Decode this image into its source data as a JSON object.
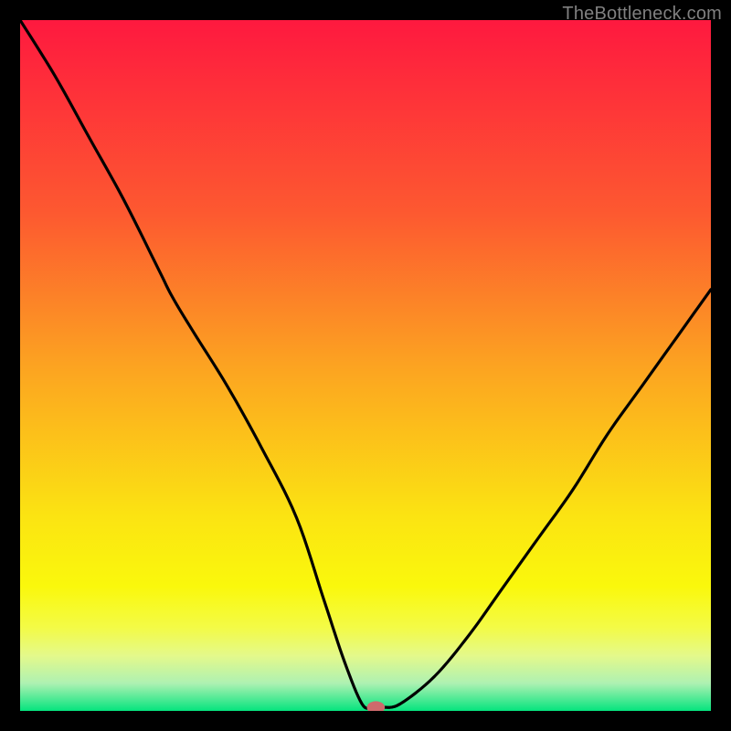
{
  "watermark": "TheBottleneck.com",
  "colors": {
    "page_bg": "#000000",
    "curve_stroke": "#000000",
    "marker_fill": "#ce6a6c",
    "watermark_text": "#808080"
  },
  "chart_data": {
    "type": "line",
    "title": "",
    "xlabel": "",
    "ylabel": "",
    "xlim": [
      0,
      100
    ],
    "ylim": [
      0,
      100
    ],
    "grid": false,
    "legend": false,
    "background_gradient": {
      "stops": [
        {
          "offset": 0.0,
          "color": "#fe193f"
        },
        {
          "offset": 0.28,
          "color": "#fd5930"
        },
        {
          "offset": 0.5,
          "color": "#fca321"
        },
        {
          "offset": 0.72,
          "color": "#fbe412"
        },
        {
          "offset": 0.82,
          "color": "#faf80c"
        },
        {
          "offset": 0.88,
          "color": "#f3fb47"
        },
        {
          "offset": 0.92,
          "color": "#e4f98b"
        },
        {
          "offset": 0.96,
          "color": "#aef1b2"
        },
        {
          "offset": 1.0,
          "color": "#05e47e"
        }
      ]
    },
    "series": [
      {
        "name": "bottleneck-curve",
        "x": [
          0,
          5,
          10,
          15,
          20,
          22,
          25,
          30,
          35,
          40,
          44,
          47,
          49.5,
          51,
          52.5,
          55,
          60,
          65,
          70,
          75,
          80,
          85,
          90,
          95,
          100
        ],
        "y": [
          100,
          92,
          83,
          74,
          64,
          60,
          55,
          47,
          38,
          28,
          16,
          7,
          1,
          0.5,
          0.5,
          1,
          5,
          11,
          18,
          25,
          32,
          40,
          47,
          54,
          61
        ]
      }
    ],
    "marker": {
      "x": 51.5,
      "y": 0.5,
      "rx": 1.3,
      "ry": 0.9
    }
  }
}
